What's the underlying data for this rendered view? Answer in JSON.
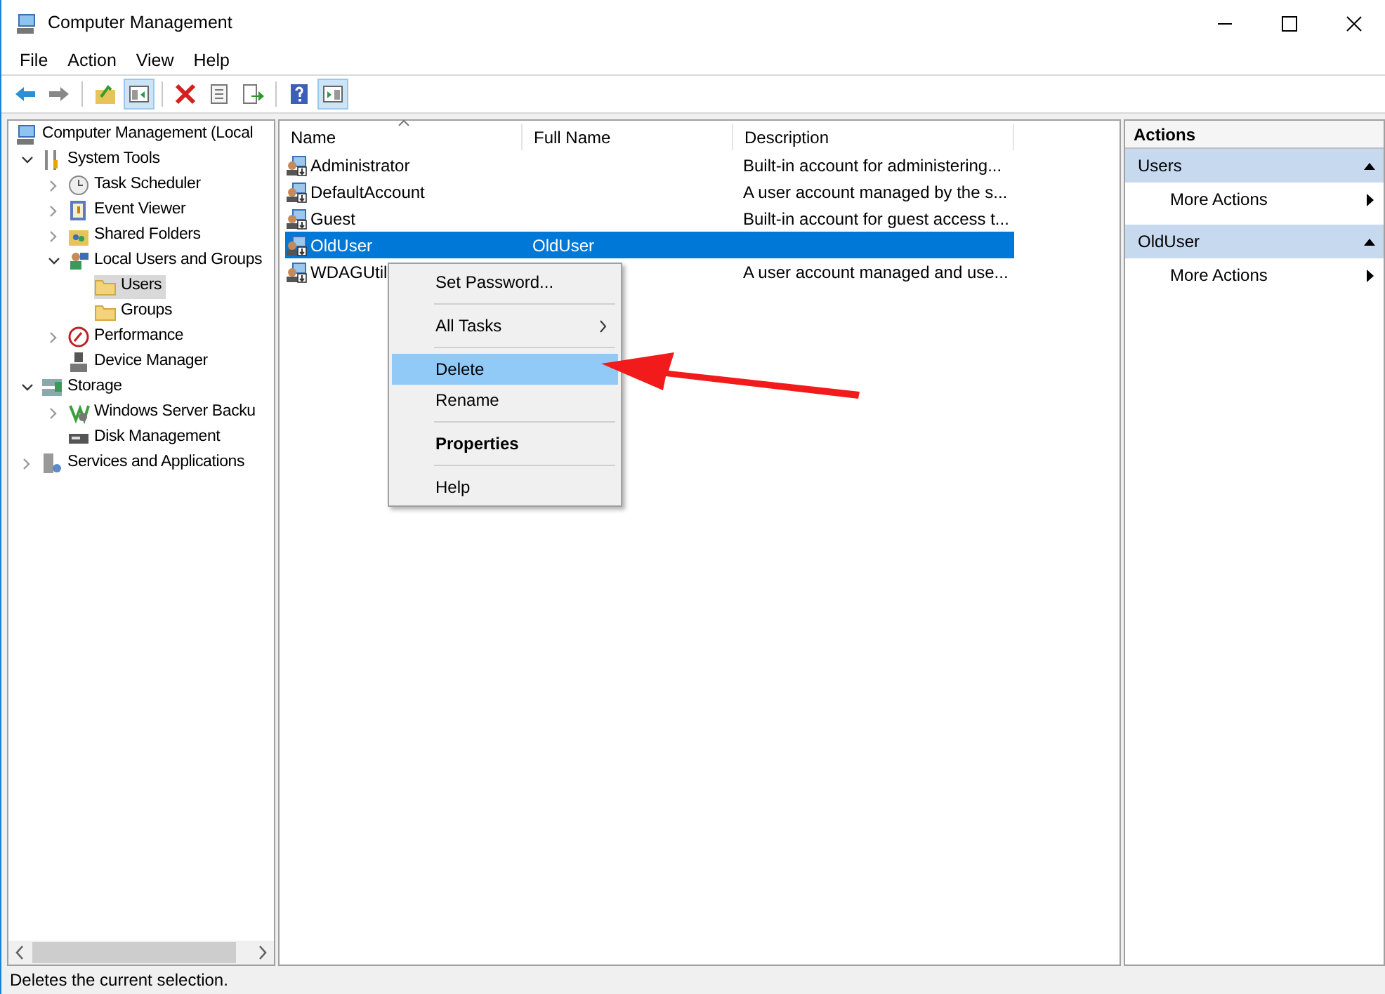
{
  "window": {
    "title": "Computer Management"
  },
  "menu_bar": [
    "File",
    "Action",
    "View",
    "Help"
  ],
  "toolbar": [
    {
      "pressed": false
    },
    {
      "pressed": false
    },
    {
      "pressed": false
    },
    {
      "pressed": true
    },
    {
      "pressed": false
    },
    {
      "pressed": false
    },
    {
      "pressed": false
    },
    {
      "pressed": false
    },
    {
      "pressed": true
    }
  ],
  "tree": [
    {
      "label": "Computer Management (Local",
      "selected": false,
      "children": [
        {
          "label": "System Tools",
          "selected": false,
          "expanded": true,
          "children": [
            {
              "label": "Task Scheduler",
              "selected": false,
              "expanded": false
            },
            {
              "label": "Event Viewer",
              "selected": false,
              "expanded": false
            },
            {
              "label": "Shared Folders",
              "selected": false,
              "expanded": false
            },
            {
              "label": "Local Users and Groups",
              "selected": false,
              "expanded": true,
              "children": [
                {
                  "label": "Users",
                  "selected": true
                },
                {
                  "label": "Groups",
                  "selected": false
                }
              ]
            },
            {
              "label": "Performance",
              "selected": false,
              "expanded": false
            },
            {
              "label": "Device Manager",
              "selected": false
            }
          ]
        },
        {
          "label": "Storage",
          "selected": false,
          "expanded": true,
          "children": [
            {
              "label": "Windows Server Backu",
              "selected": false,
              "expanded": false
            },
            {
              "label": "Disk Management",
              "selected": false
            }
          ]
        },
        {
          "label": "Services and Applications",
          "selected": false,
          "expanded": false
        }
      ]
    }
  ],
  "table": {
    "columns": [
      "Name",
      "Full Name",
      "Description"
    ],
    "rows": [
      {
        "name": "Administrator",
        "description": "Built-in account for administering...",
        "selected": false
      },
      {
        "name": "DefaultAccount",
        "description": "A user account managed by the s...",
        "selected": false
      },
      {
        "name": "Guest",
        "description": "Built-in account for guest access t...",
        "selected": false
      },
      {
        "name": "OldUser",
        "full_name": "OldUser",
        "selected": true
      },
      {
        "name": "WDAGUtil",
        "description": "A user account managed and use...",
        "selected": false
      }
    ]
  },
  "context_menu": [
    {
      "kind": "item",
      "label": "Set Password...",
      "selected": false
    },
    {
      "kind": "separator"
    },
    {
      "kind": "submenu",
      "label": "All Tasks",
      "selected": false
    },
    {
      "kind": "separator"
    },
    {
      "kind": "item",
      "label": "Delete",
      "selected": true
    },
    {
      "kind": "item",
      "label": "Rename",
      "selected": false
    },
    {
      "kind": "separator"
    },
    {
      "kind": "default",
      "label": "Properties",
      "selected": false
    },
    {
      "kind": "separator"
    },
    {
      "kind": "item",
      "label": "Help",
      "selected": false
    }
  ],
  "actions": {
    "title": "Actions",
    "groups": [
      {
        "title": "Users",
        "items": [
          "More Actions"
        ]
      },
      {
        "title": "OldUser",
        "items": [
          "More Actions"
        ]
      }
    ]
  },
  "status_bar": "Deletes the current selection."
}
